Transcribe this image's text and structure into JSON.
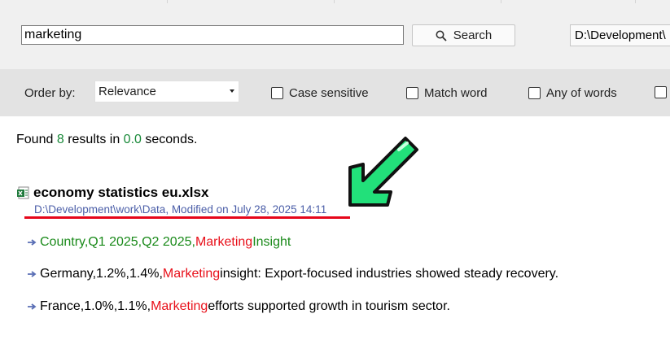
{
  "search": {
    "query": "marketing",
    "button_label": "Search",
    "path": "D:\\Development\\"
  },
  "options": {
    "order_label": "Order by:",
    "order_value": "Relevance",
    "case_sensitive": "Case sensitive",
    "match_word": "Match word",
    "any_of_words": "Any of words"
  },
  "summary": {
    "prefix": "Found",
    "count": "8",
    "middle": "results in",
    "time": "0.0",
    "suffix": "seconds."
  },
  "result": {
    "title": "economy statistics eu.xlsx",
    "meta": "D:\\Development\\work\\Data, Modified on July 28, 2025 14:11",
    "snippets": [
      {
        "pre": "Country,Q1 2025,Q2 2025,",
        "hl": "Marketing",
        "post": " Insight"
      },
      {
        "pre": "Germany,1.2%,1.4%,",
        "hl": "Marketing",
        "post": " insight: Export-focused industries showed steady recovery."
      },
      {
        "pre": "France,1.0%,1.1%,",
        "hl": "Marketing",
        "post": " efforts supported growth in tourism sector."
      }
    ]
  },
  "colors": {
    "highlight": "#e8101a",
    "count_green": "#1a8a3a",
    "meta_blue": "#4b5ea8",
    "annotation_green": "#22e07a"
  }
}
